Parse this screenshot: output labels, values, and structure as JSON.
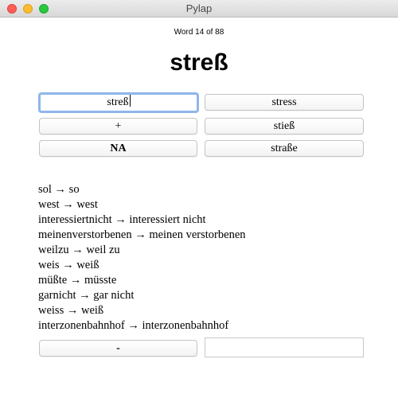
{
  "window": {
    "title": "Pylap"
  },
  "counter": "Word 14 of 88",
  "current_word": "streß",
  "input": {
    "value": "streß"
  },
  "suggestions": {
    "top_right": "stress",
    "plus": "+",
    "middle_right": "stieß",
    "na": "NA",
    "bottom_right": "straße"
  },
  "history": [
    "sol → so",
    "west → west",
    "interessiertnicht → interessiert nicht",
    "meinenverstorbenen → meinen verstorbenen",
    "weilzu → weil zu",
    "weis → weiß",
    "müßte → müsste",
    "garnicht → gar nicht",
    "weiss → weiß",
    "interzonenbahnhof → interzonenbahnhof"
  ],
  "bottom": {
    "minus": "-",
    "input_value": ""
  },
  "colors": {
    "focus_ring": "#8fb6ea",
    "close": "#fd5f57",
    "minimize": "#febc2e",
    "maximize": "#28c840"
  }
}
